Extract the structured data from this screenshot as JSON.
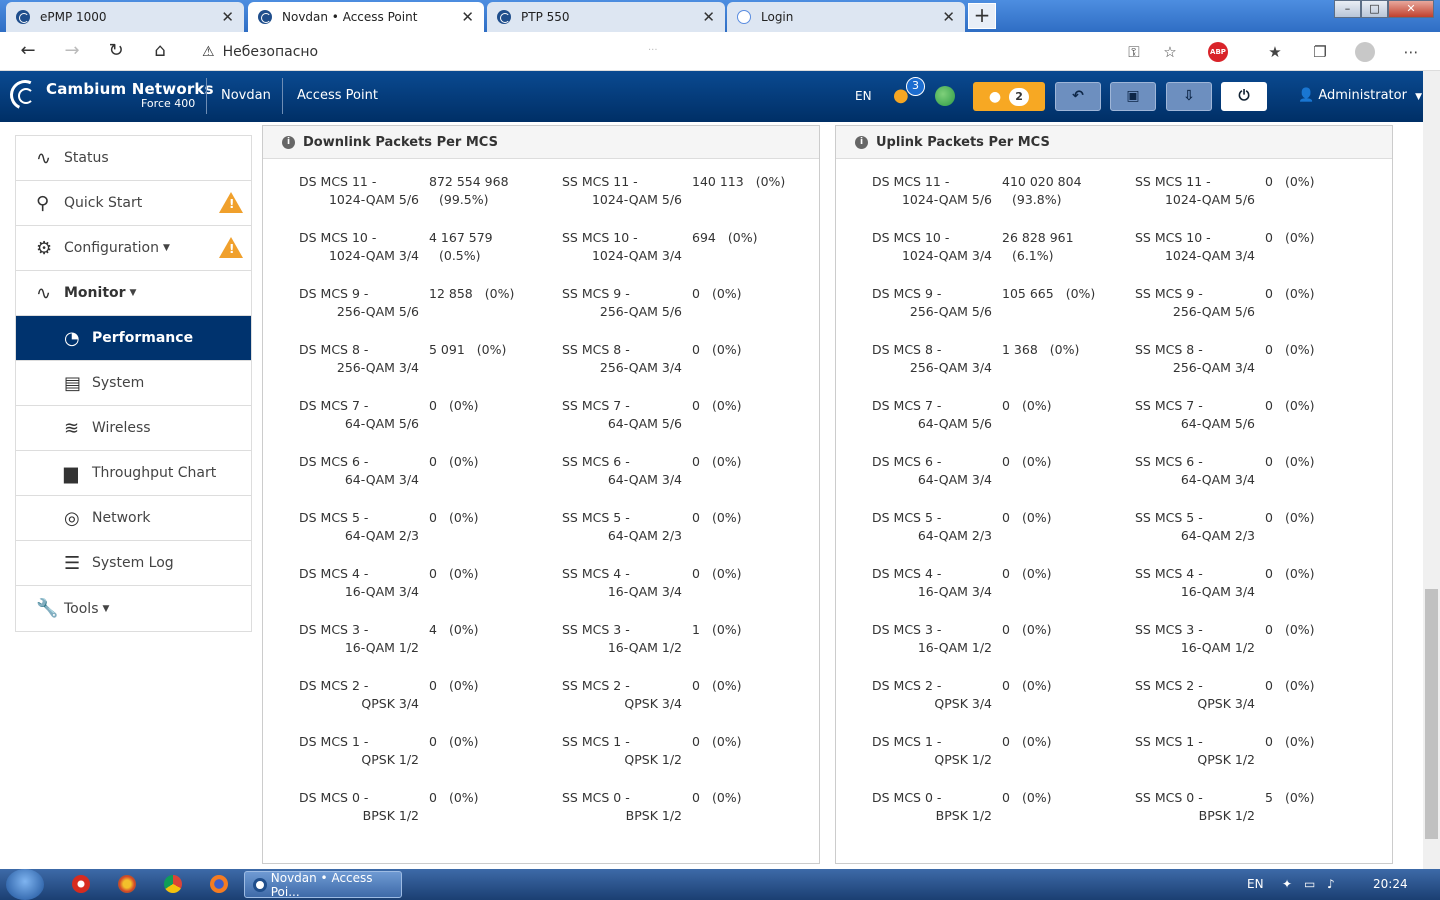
{
  "browser": {
    "tabs": [
      {
        "label": "ePMP 1000",
        "active": false
      },
      {
        "label": "Novdan • Access Point",
        "active": true
      },
      {
        "label": "PTP 550",
        "active": false
      },
      {
        "label": "Login",
        "active": false
      }
    ],
    "new_tab": "+",
    "address": {
      "security_label": "Небезопасно",
      "url_fragment": "···"
    },
    "window_controls": {
      "minimize": "–",
      "maximize": "□",
      "close": "✕"
    }
  },
  "header": {
    "brand": "Cambium Networks",
    "model": "Force 400",
    "device_name": "Novdan",
    "mode": "Access Point",
    "language": "EN",
    "users_count": "3",
    "alerts_count": "2",
    "user": "Administrator"
  },
  "sidebar": {
    "items": [
      {
        "label": "Status",
        "icon": "pulse-icon",
        "sub": false
      },
      {
        "label": "Quick Start",
        "icon": "runner-icon",
        "sub": false,
        "warning": true
      },
      {
        "label": "Configuration",
        "icon": "gear-icon",
        "sub": false,
        "caret": true,
        "warning": true
      },
      {
        "label": "Monitor",
        "icon": "pulse-icon",
        "sub": false,
        "caret": true,
        "bold": true
      },
      {
        "label": "Performance",
        "icon": "gauge-icon",
        "sub": true,
        "active": true
      },
      {
        "label": "System",
        "icon": "system-chart-icon",
        "sub": true
      },
      {
        "label": "Wireless",
        "icon": "wifi-icon",
        "sub": true
      },
      {
        "label": "Throughput Chart",
        "icon": "bar-chart-icon",
        "sub": true
      },
      {
        "label": "Network",
        "icon": "network-globe-icon",
        "sub": true
      },
      {
        "label": "System Log",
        "icon": "list-icon",
        "sub": true
      },
      {
        "label": "Tools",
        "icon": "wrench-icon",
        "sub": false,
        "caret": true
      }
    ]
  },
  "downlink": {
    "title": "Downlink Packets Per MCS",
    "ds": [
      {
        "l1": "DS MCS 11 -",
        "l2": "1024-QAM 5/6",
        "value": "872 554 968",
        "pct": "(99.5%)",
        "wrap": true
      },
      {
        "l1": "DS MCS 10 -",
        "l2": "1024-QAM 3/4",
        "value": "4 167 579",
        "pct": "(0.5%)",
        "wrap": true
      },
      {
        "l1": "DS MCS 9 -",
        "l2": "256-QAM 5/6",
        "value": "12 858",
        "pct": "(0%)",
        "wrap": false
      },
      {
        "l1": "DS MCS 8 -",
        "l2": "256-QAM 3/4",
        "value": "5 091",
        "pct": "(0%)",
        "wrap": false
      },
      {
        "l1": "DS MCS 7 -",
        "l2": "64-QAM 5/6",
        "value": "0",
        "pct": "(0%)",
        "wrap": false
      },
      {
        "l1": "DS MCS 6 -",
        "l2": "64-QAM 3/4",
        "value": "0",
        "pct": "(0%)",
        "wrap": false
      },
      {
        "l1": "DS MCS 5 -",
        "l2": "64-QAM 2/3",
        "value": "0",
        "pct": "(0%)",
        "wrap": false
      },
      {
        "l1": "DS MCS 4 -",
        "l2": "16-QAM 3/4",
        "value": "0",
        "pct": "(0%)",
        "wrap": false
      },
      {
        "l1": "DS MCS 3 -",
        "l2": "16-QAM 1/2",
        "value": "4",
        "pct": "(0%)",
        "wrap": false
      },
      {
        "l1": "DS MCS 2 -",
        "l2": "QPSK 3/4",
        "value": "0",
        "pct": "(0%)",
        "wrap": false
      },
      {
        "l1": "DS MCS 1 -",
        "l2": "QPSK 1/2",
        "value": "0",
        "pct": "(0%)",
        "wrap": false
      },
      {
        "l1": "DS MCS 0 -",
        "l2": "BPSK 1/2",
        "value": "0",
        "pct": "(0%)",
        "wrap": false
      }
    ],
    "ss": [
      {
        "l1": "SS MCS 11 -",
        "l2": "1024-QAM 5/6",
        "value": "140 113",
        "pct": "(0%)",
        "wrap": false
      },
      {
        "l1": "SS MCS 10 -",
        "l2": "1024-QAM 3/4",
        "value": "694",
        "pct": "(0%)",
        "wrap": false
      },
      {
        "l1": "SS MCS 9 -",
        "l2": "256-QAM 5/6",
        "value": "0",
        "pct": "(0%)",
        "wrap": false
      },
      {
        "l1": "SS MCS 8 -",
        "l2": "256-QAM 3/4",
        "value": "0",
        "pct": "(0%)",
        "wrap": false
      },
      {
        "l1": "SS MCS 7 -",
        "l2": "64-QAM 5/6",
        "value": "0",
        "pct": "(0%)",
        "wrap": false
      },
      {
        "l1": "SS MCS 6 -",
        "l2": "64-QAM 3/4",
        "value": "0",
        "pct": "(0%)",
        "wrap": false
      },
      {
        "l1": "SS MCS 5 -",
        "l2": "64-QAM 2/3",
        "value": "0",
        "pct": "(0%)",
        "wrap": false
      },
      {
        "l1": "SS MCS 4 -",
        "l2": "16-QAM 3/4",
        "value": "0",
        "pct": "(0%)",
        "wrap": false
      },
      {
        "l1": "SS MCS 3 -",
        "l2": "16-QAM 1/2",
        "value": "1",
        "pct": "(0%)",
        "wrap": false
      },
      {
        "l1": "SS MCS 2 -",
        "l2": "QPSK 3/4",
        "value": "0",
        "pct": "(0%)",
        "wrap": false
      },
      {
        "l1": "SS MCS 1 -",
        "l2": "QPSK 1/2",
        "value": "0",
        "pct": "(0%)",
        "wrap": false
      },
      {
        "l1": "SS MCS 0 -",
        "l2": "BPSK 1/2",
        "value": "0",
        "pct": "(0%)",
        "wrap": false
      }
    ]
  },
  "uplink": {
    "title": "Uplink Packets Per MCS",
    "ds": [
      {
        "l1": "DS MCS 11 -",
        "l2": "1024-QAM 5/6",
        "value": "410 020 804",
        "pct": "(93.8%)",
        "wrap": true
      },
      {
        "l1": "DS MCS 10 -",
        "l2": "1024-QAM 3/4",
        "value": "26 828 961",
        "pct": "(6.1%)",
        "wrap": true
      },
      {
        "l1": "DS MCS 9 -",
        "l2": "256-QAM 5/6",
        "value": "105 665",
        "pct": "(0%)",
        "wrap": false
      },
      {
        "l1": "DS MCS 8 -",
        "l2": "256-QAM 3/4",
        "value": "1 368",
        "pct": "(0%)",
        "wrap": false
      },
      {
        "l1": "DS MCS 7 -",
        "l2": "64-QAM 5/6",
        "value": "0",
        "pct": "(0%)",
        "wrap": false
      },
      {
        "l1": "DS MCS 6 -",
        "l2": "64-QAM 3/4",
        "value": "0",
        "pct": "(0%)",
        "wrap": false
      },
      {
        "l1": "DS MCS 5 -",
        "l2": "64-QAM 2/3",
        "value": "0",
        "pct": "(0%)",
        "wrap": false
      },
      {
        "l1": "DS MCS 4 -",
        "l2": "16-QAM 3/4",
        "value": "0",
        "pct": "(0%)",
        "wrap": false
      },
      {
        "l1": "DS MCS 3 -",
        "l2": "16-QAM 1/2",
        "value": "0",
        "pct": "(0%)",
        "wrap": false
      },
      {
        "l1": "DS MCS 2 -",
        "l2": "QPSK 3/4",
        "value": "0",
        "pct": "(0%)",
        "wrap": false
      },
      {
        "l1": "DS MCS 1 -",
        "l2": "QPSK 1/2",
        "value": "0",
        "pct": "(0%)",
        "wrap": false
      },
      {
        "l1": "DS MCS 0 -",
        "l2": "BPSK 1/2",
        "value": "0",
        "pct": "(0%)",
        "wrap": false
      }
    ],
    "ss": [
      {
        "l1": "SS MCS 11 -",
        "l2": "1024-QAM 5/6",
        "value": "0",
        "pct": "(0%)",
        "wrap": false
      },
      {
        "l1": "SS MCS 10 -",
        "l2": "1024-QAM 3/4",
        "value": "0",
        "pct": "(0%)",
        "wrap": false
      },
      {
        "l1": "SS MCS 9 -",
        "l2": "256-QAM 5/6",
        "value": "0",
        "pct": "(0%)",
        "wrap": false
      },
      {
        "l1": "SS MCS 8 -",
        "l2": "256-QAM 3/4",
        "value": "0",
        "pct": "(0%)",
        "wrap": false
      },
      {
        "l1": "SS MCS 7 -",
        "l2": "64-QAM 5/6",
        "value": "0",
        "pct": "(0%)",
        "wrap": false
      },
      {
        "l1": "SS MCS 6 -",
        "l2": "64-QAM 3/4",
        "value": "0",
        "pct": "(0%)",
        "wrap": false
      },
      {
        "l1": "SS MCS 5 -",
        "l2": "64-QAM 2/3",
        "value": "0",
        "pct": "(0%)",
        "wrap": false
      },
      {
        "l1": "SS MCS 4 -",
        "l2": "16-QAM 3/4",
        "value": "0",
        "pct": "(0%)",
        "wrap": false
      },
      {
        "l1": "SS MCS 3 -",
        "l2": "16-QAM 1/2",
        "value": "0",
        "pct": "(0%)",
        "wrap": false
      },
      {
        "l1": "SS MCS 2 -",
        "l2": "QPSK 3/4",
        "value": "0",
        "pct": "(0%)",
        "wrap": false
      },
      {
        "l1": "SS MCS 1 -",
        "l2": "QPSK 1/2",
        "value": "0",
        "pct": "(0%)",
        "wrap": false
      },
      {
        "l1": "SS MCS 0 -",
        "l2": "BPSK 1/2",
        "value": "5",
        "pct": "(0%)",
        "wrap": false
      }
    ]
  },
  "taskbar": {
    "active_task": "Novdan • Access Poi...",
    "lang": "EN",
    "time": "20:24"
  },
  "colors": {
    "header": "#003b7d",
    "active_nav": "#00336e",
    "warning": "#f0a02c",
    "alert_button": "#f7a823"
  }
}
